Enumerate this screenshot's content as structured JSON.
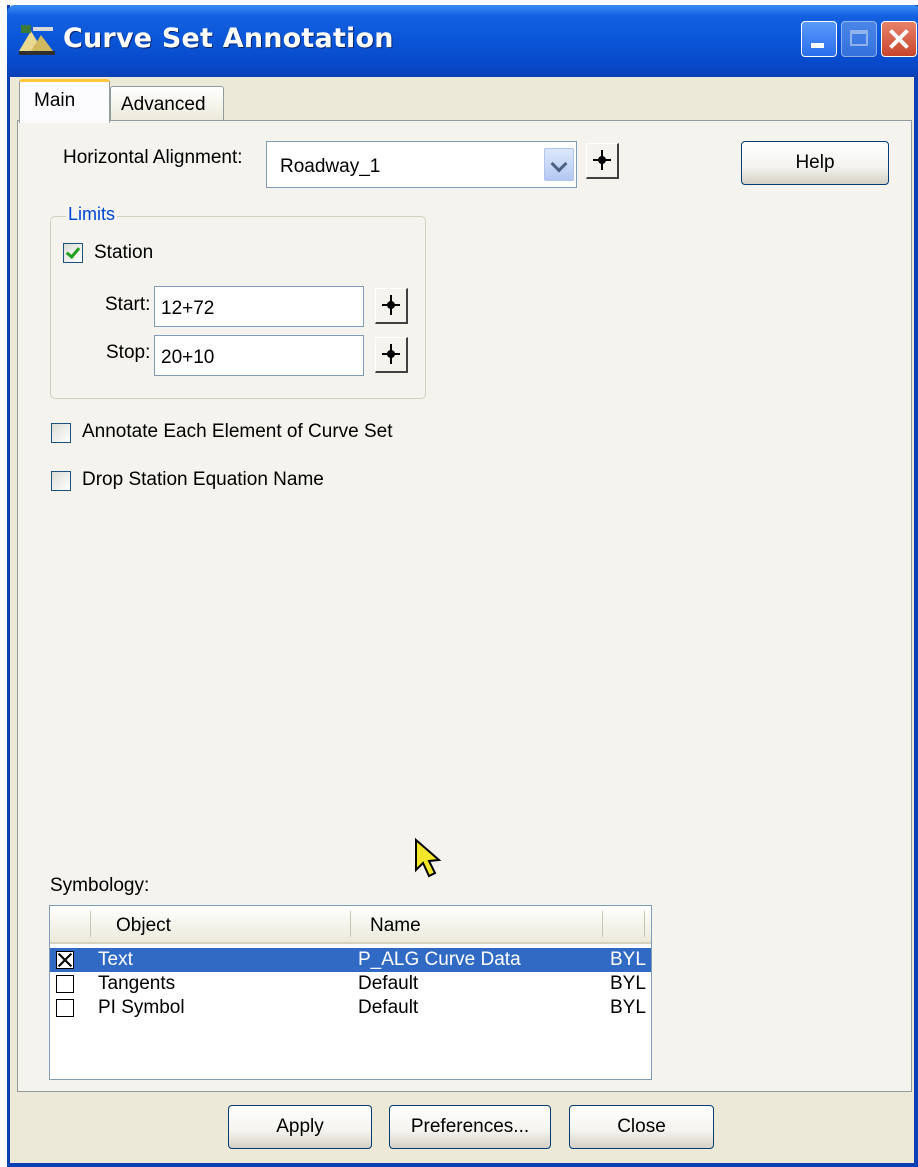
{
  "window": {
    "title": "Curve Set Annotation"
  },
  "tabs": [
    {
      "label": "Main",
      "selected": true
    },
    {
      "label": "Advanced",
      "selected": false
    }
  ],
  "main": {
    "horizontal_alignment": {
      "label": "Horizontal Alignment:",
      "value": "Roadway_1"
    },
    "help_button": "Help",
    "limits": {
      "title": "Limits",
      "station": {
        "label": "Station",
        "checked": true
      },
      "start": {
        "label": "Start:",
        "value": "12+72"
      },
      "stop": {
        "label": "Stop:",
        "value": "20+10"
      }
    },
    "annotate_each": {
      "label": "Annotate Each Element of Curve Set",
      "checked": false
    },
    "drop_equation": {
      "label": "Drop Station Equation Name",
      "checked": false
    },
    "symbology": {
      "label": "Symbology:",
      "columns": [
        "Object",
        "Name"
      ],
      "rows": [
        {
          "checked": true,
          "object": "Text",
          "name": "P_ALG Curve Data",
          "extra": "BYL",
          "selected": true
        },
        {
          "checked": false,
          "object": "Tangents",
          "name": "Default",
          "extra": "BYL",
          "selected": false
        },
        {
          "checked": false,
          "object": "PI Symbol",
          "name": "Default",
          "extra": "BYL",
          "selected": false
        }
      ]
    }
  },
  "footer": {
    "apply": "Apply",
    "preferences": "Preferences...",
    "close": "Close"
  },
  "colors": {
    "title_bar": "#0a55d8",
    "selection": "#316ac5",
    "group_title": "#0046d5",
    "check_green": "#21a121"
  },
  "icons": [
    "app-icon",
    "minimize-icon",
    "maximize-icon",
    "close-icon",
    "locate-crosshair-icon",
    "chevron-down-icon",
    "checkmark-icon",
    "mouse-pointer-icon"
  ]
}
